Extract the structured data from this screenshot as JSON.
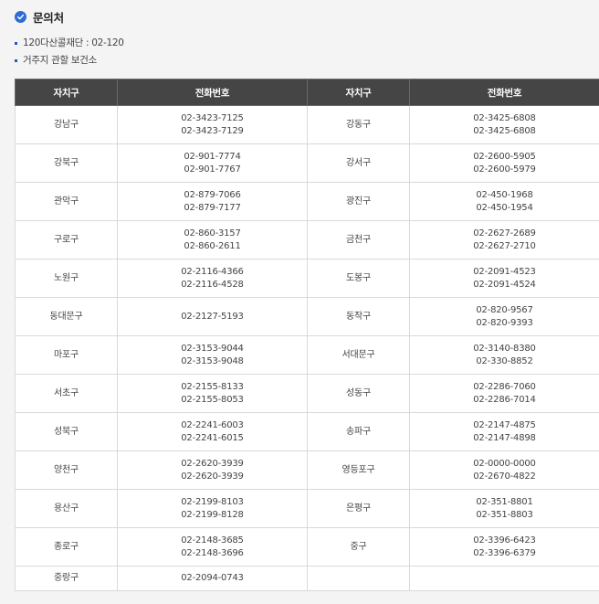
{
  "heading": {
    "title": "문의처",
    "icon": "check-circle-icon",
    "icon_color": "#2f6cd3"
  },
  "bullets": [
    "120다산콜재단 : 02-120",
    "거주지 관할 보건소"
  ],
  "table": {
    "headers": [
      "자치구",
      "전화번호",
      "자치구",
      "전화번호"
    ],
    "header_bg": "#454545",
    "rows": [
      [
        {
          "district": "강남구",
          "phones": [
            "02-3423-7125",
            "02-3423-7129"
          ]
        },
        {
          "district": "강동구",
          "phones": [
            "02-3425-6808",
            "02-3425-6808"
          ]
        }
      ],
      [
        {
          "district": "강북구",
          "phones": [
            "02-901-7774",
            "02-901-7767"
          ]
        },
        {
          "district": "강서구",
          "phones": [
            "02-2600-5905",
            "02-2600-5979"
          ]
        }
      ],
      [
        {
          "district": "관악구",
          "phones": [
            "02-879-7066",
            "02-879-7177"
          ]
        },
        {
          "district": "광진구",
          "phones": [
            "02-450-1968",
            "02-450-1954"
          ]
        }
      ],
      [
        {
          "district": "구로구",
          "phones": [
            "02-860-3157",
            "02-860-2611"
          ]
        },
        {
          "district": "금천구",
          "phones": [
            "02-2627-2689",
            "02-2627-2710"
          ]
        }
      ],
      [
        {
          "district": "노원구",
          "phones": [
            "02-2116-4366",
            "02-2116-4528"
          ]
        },
        {
          "district": "도봉구",
          "phones": [
            "02-2091-4523",
            "02-2091-4524"
          ]
        }
      ],
      [
        {
          "district": "동대문구",
          "phones": [
            "02-2127-5193"
          ]
        },
        {
          "district": "동작구",
          "phones": [
            "02-820-9567",
            "02-820-9393"
          ]
        }
      ],
      [
        {
          "district": "마포구",
          "phones": [
            "02-3153-9044",
            "02-3153-9048"
          ]
        },
        {
          "district": "서대문구",
          "phones": [
            "02-3140-8380",
            "02-330-8852"
          ]
        }
      ],
      [
        {
          "district": "서초구",
          "phones": [
            "02-2155-8133",
            "02-2155-8053"
          ]
        },
        {
          "district": "성동구",
          "phones": [
            "02-2286-7060",
            "02-2286-7014"
          ]
        }
      ],
      [
        {
          "district": "성북구",
          "phones": [
            "02-2241-6003",
            "02-2241-6015"
          ]
        },
        {
          "district": "송파구",
          "phones": [
            "02-2147-4875",
            "02-2147-4898"
          ]
        }
      ],
      [
        {
          "district": "양천구",
          "phones": [
            "02-2620-3939",
            "02-2620-3939"
          ]
        },
        {
          "district": "영등포구",
          "phones": [
            "02-0000-0000",
            "02-2670-4822"
          ]
        }
      ],
      [
        {
          "district": "용산구",
          "phones": [
            "02-2199-8103",
            "02-2199-8128"
          ]
        },
        {
          "district": "은평구",
          "phones": [
            "02-351-8801",
            "02-351-8803"
          ]
        }
      ],
      [
        {
          "district": "종로구",
          "phones": [
            "02-2148-3685",
            "02-2148-3696"
          ]
        },
        {
          "district": "중구",
          "phones": [
            "02-3396-6423",
            "02-3396-6379"
          ]
        }
      ],
      [
        {
          "district": "중랑구",
          "phones": [
            "02-2094-0743"
          ]
        },
        {
          "district": "",
          "phones": []
        }
      ]
    ]
  }
}
